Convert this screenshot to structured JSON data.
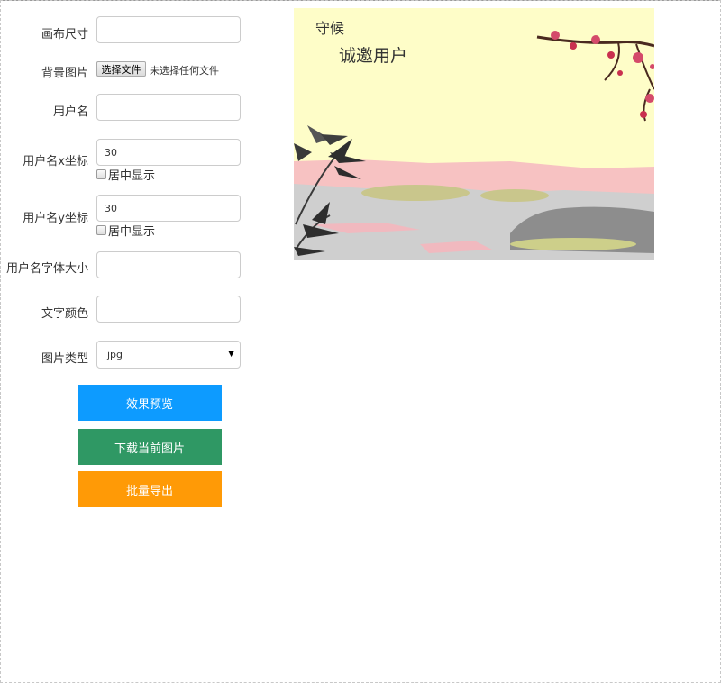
{
  "form": {
    "canvas_size": {
      "label": "画布尺寸",
      "value": ""
    },
    "background": {
      "label": "背景图片",
      "button": "选择文件",
      "status": "未选择任何文件"
    },
    "username": {
      "label": "用户名",
      "value": ""
    },
    "username_x": {
      "label": "用户名x坐标",
      "value": "30",
      "center_label": "居中显示"
    },
    "username_y": {
      "label": "用户名y坐标",
      "value": "30",
      "center_label": "居中显示"
    },
    "font_size": {
      "label": "用户名字体大小",
      "value": ""
    },
    "text_color": {
      "label": "文字颜色",
      "value": ""
    },
    "image_type": {
      "label": "图片类型",
      "value": "jpg"
    }
  },
  "buttons": {
    "preview": "效果预览",
    "download": "下载当前图片",
    "export": "批量导出"
  },
  "preview": {
    "username_text": "守候",
    "invite_text": "诚邀用户"
  },
  "colors": {
    "preview_button": "#0d9bff",
    "download_button": "#2f9864",
    "export_button": "#ff9a06"
  }
}
